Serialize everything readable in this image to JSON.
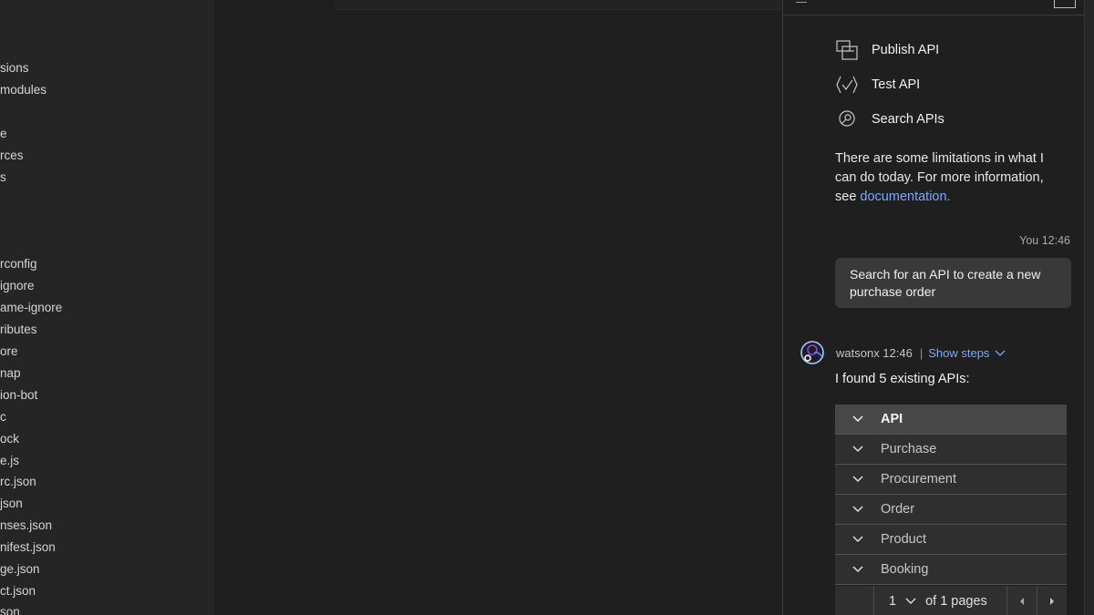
{
  "explorer": {
    "items": [
      "sions",
      "modules",
      "e",
      "rces",
      "s",
      "rconfig",
      "ignore",
      "ame-ignore",
      "ributes",
      "ore",
      "nap",
      "ion-bot",
      "c",
      "ock",
      "e.js",
      "rc.json",
      "json",
      "nses.json",
      "nifest.json",
      "ge.json",
      "ct.json",
      "son"
    ]
  },
  "panel": {
    "capabilities": [
      {
        "label": "Publish API",
        "icon": "publish-icon"
      },
      {
        "label": "Test API",
        "icon": "test-check-icon"
      },
      {
        "label": "Search APIs",
        "icon": "search-icon"
      }
    ],
    "limitations_text": "There are some limitations in what I can do today. For more information, see ",
    "limitations_link": "documentation.",
    "user_meta": "You 12:46",
    "user_message": "Search for an API to create a new purchase order",
    "bot_name_time": "watsonx 12:46",
    "bot_separator": "|",
    "show_steps_label": "Show steps",
    "bot_intro": "I found 5 existing APIs:",
    "table": {
      "header": "API",
      "rows": [
        "Purchase",
        "Procurement",
        "Order",
        "Product",
        "Booking"
      ]
    },
    "pagination": {
      "page": "1",
      "of_pages": "of 1 pages"
    }
  },
  "colors": {
    "link": "#78a9ff",
    "panel_bg": "#1f1f1f",
    "table_header_bg": "#474747",
    "table_row_bg": "#2f2f2f"
  }
}
